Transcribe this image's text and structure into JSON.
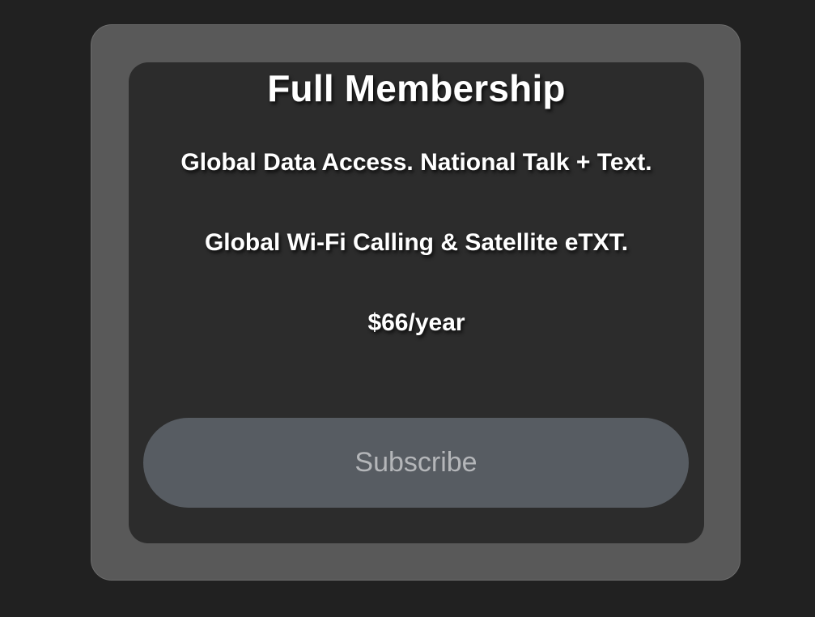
{
  "plan": {
    "title": "Full Membership",
    "features": [
      "Global Data Access. National Talk + Text.",
      "Global Wi-Fi Calling & Satellite eTXT."
    ],
    "price": "$66/year",
    "subscribe_label": "Subscribe"
  },
  "colors": {
    "page_background": "#212121",
    "frame_background": "#595959",
    "card_background": "#2c2c2c",
    "button_background": "#575c62",
    "button_text": "#b4b6b9",
    "text": "#ffffff"
  }
}
